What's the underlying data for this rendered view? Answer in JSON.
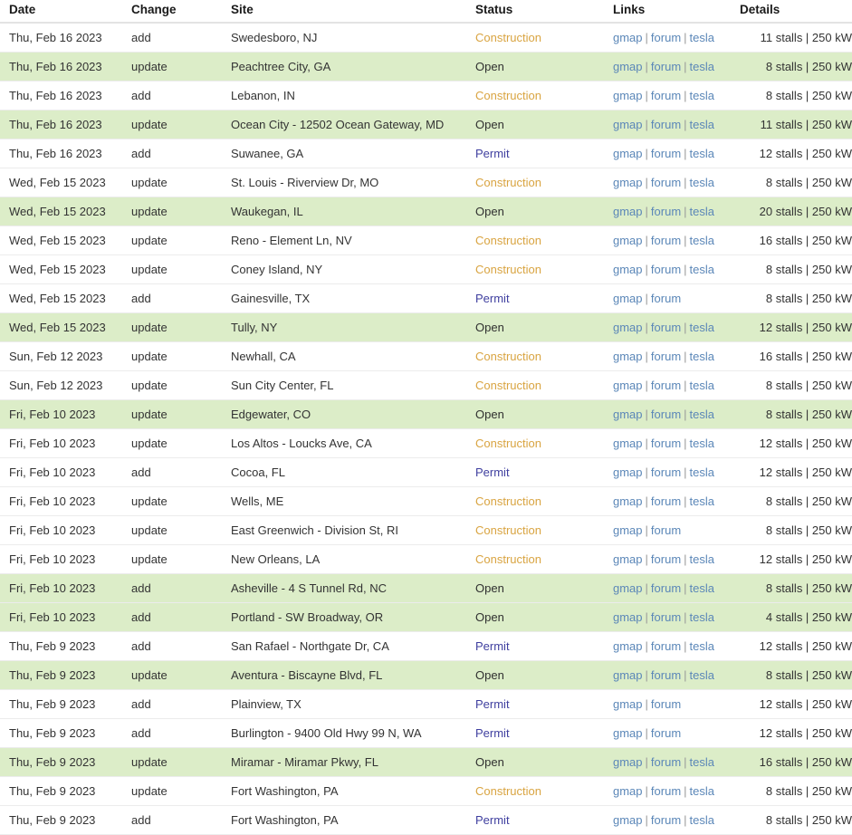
{
  "table": {
    "columns": [
      {
        "key": "date",
        "label": "Date"
      },
      {
        "key": "change",
        "label": "Change"
      },
      {
        "key": "site",
        "label": "Site"
      },
      {
        "key": "status",
        "label": "Status"
      },
      {
        "key": "links",
        "label": "Links"
      },
      {
        "key": "details",
        "label": "Details"
      }
    ],
    "link_labels": {
      "gmap": "gmap",
      "forum": "forum",
      "tesla": "tesla",
      "separator": "|"
    },
    "status_colors": {
      "Construction": "#d9a441",
      "Open": "#2f2f2f",
      "Permit": "#3f3f9f"
    },
    "row_highlight_color": "#dcedc8",
    "link_color": "#5b87b8",
    "rows": [
      {
        "date": "Thu, Feb 16 2023",
        "change": "add",
        "site": "Swedesboro, NJ",
        "status": "Construction",
        "links": [
          "gmap",
          "forum",
          "tesla"
        ],
        "details": "11 stalls | 250 kW",
        "highlight": false
      },
      {
        "date": "Thu, Feb 16 2023",
        "change": "update",
        "site": "Peachtree City, GA",
        "status": "Open",
        "links": [
          "gmap",
          "forum",
          "tesla"
        ],
        "details": "8 stalls | 250 kW",
        "highlight": true
      },
      {
        "date": "Thu, Feb 16 2023",
        "change": "add",
        "site": "Lebanon, IN",
        "status": "Construction",
        "links": [
          "gmap",
          "forum",
          "tesla"
        ],
        "details": "8 stalls | 250 kW",
        "highlight": false
      },
      {
        "date": "Thu, Feb 16 2023",
        "change": "update",
        "site": "Ocean City - 12502 Ocean Gateway, MD",
        "status": "Open",
        "links": [
          "gmap",
          "forum",
          "tesla"
        ],
        "details": "11 stalls | 250 kW",
        "highlight": true
      },
      {
        "date": "Thu, Feb 16 2023",
        "change": "add",
        "site": "Suwanee, GA",
        "status": "Permit",
        "links": [
          "gmap",
          "forum",
          "tesla"
        ],
        "details": "12 stalls | 250 kW",
        "highlight": false
      },
      {
        "date": "Wed, Feb 15 2023",
        "change": "update",
        "site": "St. Louis - Riverview Dr, MO",
        "status": "Construction",
        "links": [
          "gmap",
          "forum",
          "tesla"
        ],
        "details": "8 stalls | 250 kW",
        "highlight": false
      },
      {
        "date": "Wed, Feb 15 2023",
        "change": "update",
        "site": "Waukegan, IL",
        "status": "Open",
        "links": [
          "gmap",
          "forum",
          "tesla"
        ],
        "details": "20 stalls | 250 kW",
        "highlight": true
      },
      {
        "date": "Wed, Feb 15 2023",
        "change": "update",
        "site": "Reno - Element Ln, NV",
        "status": "Construction",
        "links": [
          "gmap",
          "forum",
          "tesla"
        ],
        "details": "16 stalls | 250 kW",
        "highlight": false
      },
      {
        "date": "Wed, Feb 15 2023",
        "change": "update",
        "site": "Coney Island, NY",
        "status": "Construction",
        "links": [
          "gmap",
          "forum",
          "tesla"
        ],
        "details": "8 stalls | 250 kW",
        "highlight": false
      },
      {
        "date": "Wed, Feb 15 2023",
        "change": "add",
        "site": "Gainesville, TX",
        "status": "Permit",
        "links": [
          "gmap",
          "forum"
        ],
        "details": "8 stalls | 250 kW",
        "highlight": false
      },
      {
        "date": "Wed, Feb 15 2023",
        "change": "update",
        "site": "Tully, NY",
        "status": "Open",
        "links": [
          "gmap",
          "forum",
          "tesla"
        ],
        "details": "12 stalls | 250 kW",
        "highlight": true
      },
      {
        "date": "Sun, Feb 12 2023",
        "change": "update",
        "site": "Newhall, CA",
        "status": "Construction",
        "links": [
          "gmap",
          "forum",
          "tesla"
        ],
        "details": "16 stalls | 250 kW",
        "highlight": false
      },
      {
        "date": "Sun, Feb 12 2023",
        "change": "update",
        "site": "Sun City Center, FL",
        "status": "Construction",
        "links": [
          "gmap",
          "forum",
          "tesla"
        ],
        "details": "8 stalls | 250 kW",
        "highlight": false
      },
      {
        "date": "Fri, Feb 10 2023",
        "change": "update",
        "site": "Edgewater, CO",
        "status": "Open",
        "links": [
          "gmap",
          "forum",
          "tesla"
        ],
        "details": "8 stalls | 250 kW",
        "highlight": true
      },
      {
        "date": "Fri, Feb 10 2023",
        "change": "update",
        "site": "Los Altos - Loucks Ave, CA",
        "status": "Construction",
        "links": [
          "gmap",
          "forum",
          "tesla"
        ],
        "details": "12 stalls | 250 kW",
        "highlight": false
      },
      {
        "date": "Fri, Feb 10 2023",
        "change": "add",
        "site": "Cocoa, FL",
        "status": "Permit",
        "links": [
          "gmap",
          "forum",
          "tesla"
        ],
        "details": "12 stalls | 250 kW",
        "highlight": false
      },
      {
        "date": "Fri, Feb 10 2023",
        "change": "update",
        "site": "Wells, ME",
        "status": "Construction",
        "links": [
          "gmap",
          "forum",
          "tesla"
        ],
        "details": "8 stalls | 250 kW",
        "highlight": false
      },
      {
        "date": "Fri, Feb 10 2023",
        "change": "update",
        "site": "East Greenwich - Division St, RI",
        "status": "Construction",
        "links": [
          "gmap",
          "forum"
        ],
        "details": "8 stalls | 250 kW",
        "highlight": false
      },
      {
        "date": "Fri, Feb 10 2023",
        "change": "update",
        "site": "New Orleans, LA",
        "status": "Construction",
        "links": [
          "gmap",
          "forum",
          "tesla"
        ],
        "details": "12 stalls | 250 kW",
        "highlight": false
      },
      {
        "date": "Fri, Feb 10 2023",
        "change": "add",
        "site": "Asheville - 4 S Tunnel Rd, NC",
        "status": "Open",
        "links": [
          "gmap",
          "forum",
          "tesla"
        ],
        "details": "8 stalls | 250 kW",
        "highlight": true
      },
      {
        "date": "Fri, Feb 10 2023",
        "change": "add",
        "site": "Portland - SW Broadway, OR",
        "status": "Open",
        "links": [
          "gmap",
          "forum",
          "tesla"
        ],
        "details": "4 stalls | 250 kW",
        "highlight": true
      },
      {
        "date": "Thu, Feb 9 2023",
        "change": "add",
        "site": "San Rafael - Northgate Dr, CA",
        "status": "Permit",
        "links": [
          "gmap",
          "forum",
          "tesla"
        ],
        "details": "12 stalls | 250 kW",
        "highlight": false
      },
      {
        "date": "Thu, Feb 9 2023",
        "change": "update",
        "site": "Aventura - Biscayne Blvd, FL",
        "status": "Open",
        "links": [
          "gmap",
          "forum",
          "tesla"
        ],
        "details": "8 stalls | 250 kW",
        "highlight": true
      },
      {
        "date": "Thu, Feb 9 2023",
        "change": "add",
        "site": "Plainview, TX",
        "status": "Permit",
        "links": [
          "gmap",
          "forum"
        ],
        "details": "12 stalls | 250 kW",
        "highlight": false
      },
      {
        "date": "Thu, Feb 9 2023",
        "change": "add",
        "site": "Burlington - 9400 Old Hwy 99 N, WA",
        "status": "Permit",
        "links": [
          "gmap",
          "forum"
        ],
        "details": "12 stalls | 250 kW",
        "highlight": false
      },
      {
        "date": "Thu, Feb 9 2023",
        "change": "update",
        "site": "Miramar - Miramar Pkwy, FL",
        "status": "Open",
        "links": [
          "gmap",
          "forum",
          "tesla"
        ],
        "details": "16 stalls | 250 kW",
        "highlight": true
      },
      {
        "date": "Thu, Feb 9 2023",
        "change": "update",
        "site": "Fort Washington, PA",
        "status": "Construction",
        "links": [
          "gmap",
          "forum",
          "tesla"
        ],
        "details": "8 stalls | 250 kW",
        "highlight": false
      },
      {
        "date": "Thu, Feb 9 2023",
        "change": "add",
        "site": "Fort Washington, PA",
        "status": "Permit",
        "links": [
          "gmap",
          "forum",
          "tesla"
        ],
        "details": "8 stalls | 250 kW",
        "highlight": false
      }
    ]
  }
}
